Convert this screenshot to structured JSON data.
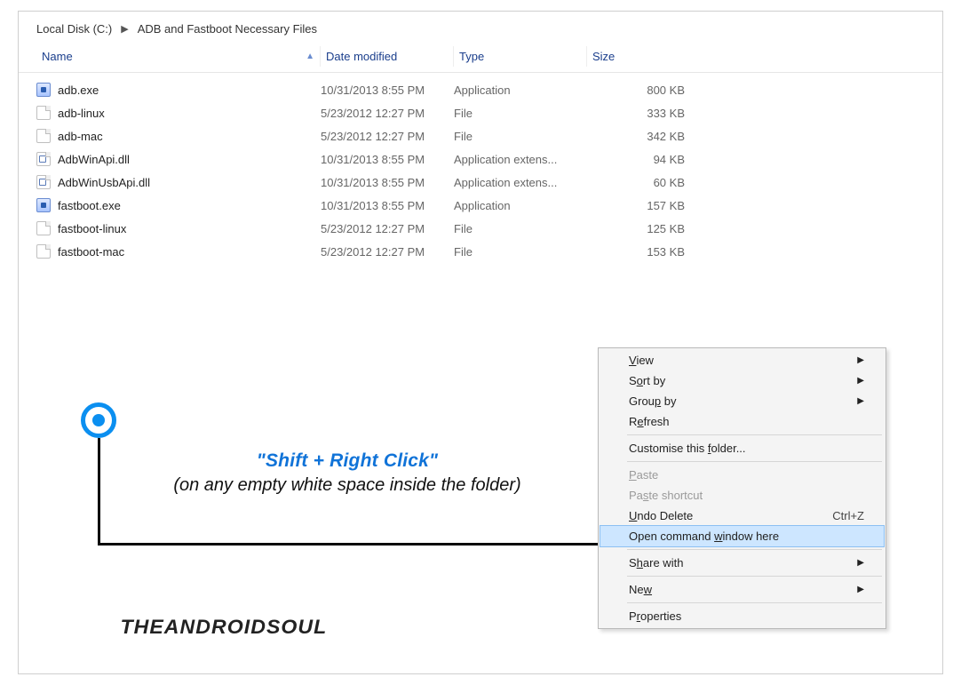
{
  "breadcrumb": {
    "part1": "Local Disk (C:)",
    "part2": "ADB and Fastboot Necessary Files"
  },
  "columns": {
    "name": "Name",
    "date": "Date modified",
    "type": "Type",
    "size": "Size"
  },
  "files": [
    {
      "name": "adb.exe",
      "date": "10/31/2013 8:55 PM",
      "type": "Application",
      "size": "800 KB",
      "icon": "exe"
    },
    {
      "name": "adb-linux",
      "date": "5/23/2012 12:27 PM",
      "type": "File",
      "size": "333 KB",
      "icon": "file"
    },
    {
      "name": "adb-mac",
      "date": "5/23/2012 12:27 PM",
      "type": "File",
      "size": "342 KB",
      "icon": "file"
    },
    {
      "name": "AdbWinApi.dll",
      "date": "10/31/2013 8:55 PM",
      "type": "Application extens...",
      "size": "94 KB",
      "icon": "dll"
    },
    {
      "name": "AdbWinUsbApi.dll",
      "date": "10/31/2013 8:55 PM",
      "type": "Application extens...",
      "size": "60 KB",
      "icon": "dll"
    },
    {
      "name": "fastboot.exe",
      "date": "10/31/2013 8:55 PM",
      "type": "Application",
      "size": "157 KB",
      "icon": "exe"
    },
    {
      "name": "fastboot-linux",
      "date": "5/23/2012 12:27 PM",
      "type": "File",
      "size": "125 KB",
      "icon": "file"
    },
    {
      "name": "fastboot-mac",
      "date": "5/23/2012 12:27 PM",
      "type": "File",
      "size": "153 KB",
      "icon": "file"
    }
  ],
  "annotation": {
    "line1": "\"Shift + Right Click\"",
    "line2": "(on any empty white space inside the folder)"
  },
  "watermark": "THEANDROIDSOUL",
  "contextmenu": {
    "view": {
      "label": "View",
      "mn": "V",
      "submenu": true
    },
    "sortby": {
      "label": "Sort by",
      "mn": "o",
      "submenu": true
    },
    "groupby": {
      "label": "Group by",
      "mn": "p",
      "submenu": true
    },
    "refresh": {
      "label": "Refresh",
      "mn": "e"
    },
    "customise": {
      "label": "Customise this folder...",
      "mn": "f"
    },
    "paste": {
      "label": "Paste",
      "mn": "P",
      "disabled": true
    },
    "pasteshort": {
      "label": "Paste shortcut",
      "mn": "s",
      "disabled": true
    },
    "undo": {
      "label": "Undo Delete",
      "mn": "U",
      "shortcut": "Ctrl+Z"
    },
    "opencmd": {
      "label": "Open command window here",
      "mn": "w",
      "highlight": true
    },
    "sharewith": {
      "label": "Share with",
      "mn": "h",
      "submenu": true
    },
    "new": {
      "label": "New",
      "mn": "w",
      "submenu": true
    },
    "properties": {
      "label": "Properties",
      "mn": "r"
    }
  }
}
